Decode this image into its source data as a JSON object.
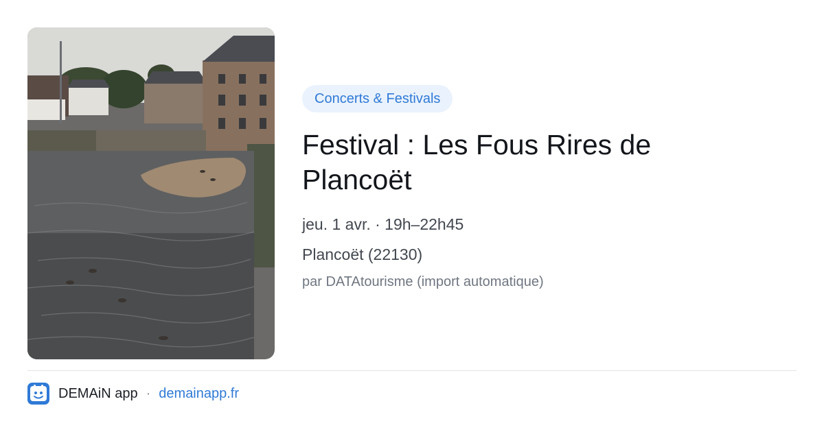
{
  "event": {
    "category": "Concerts & Festivals",
    "title": "Festival : Les Fous Rires de Plancoët",
    "datetime": "jeu. 1 avr. · 19h–22h45",
    "location": "Plancoët (22130)",
    "source": "par DATAtourisme (import automatique)",
    "image_alt": "River with ducks in front of a stone mill building in Plancoët"
  },
  "footer": {
    "app_name": "DEMAiN app",
    "separator": "·",
    "site": "demainapp.fr",
    "logo_icon": "calendar-face-icon"
  },
  "colors": {
    "accent": "#2f7ad6",
    "chip_bg": "#eaf2fd",
    "title": "#13161b",
    "meta": "#42474f",
    "muted": "#6f7681"
  }
}
